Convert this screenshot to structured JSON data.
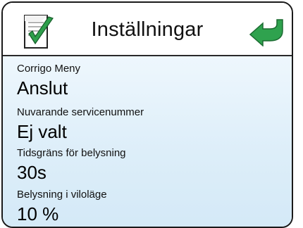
{
  "header": {
    "title": "Inställningar",
    "left_icon": "document-checkmark-icon",
    "right_icon": "back-arrow-icon"
  },
  "settings": [
    {
      "label": "Corrigo Meny",
      "value": "Anslut"
    },
    {
      "label": "Nuvarande servicenummer",
      "value": "Ej valt"
    },
    {
      "label": "Tidsgräns för belysning",
      "value": "30s"
    },
    {
      "label": "Belysning i viloläge",
      "value": "10 %"
    }
  ],
  "colors": {
    "accent_green": "#2e9f4b",
    "content_background": "#e3f1fb",
    "border": "#1a1a1a"
  }
}
